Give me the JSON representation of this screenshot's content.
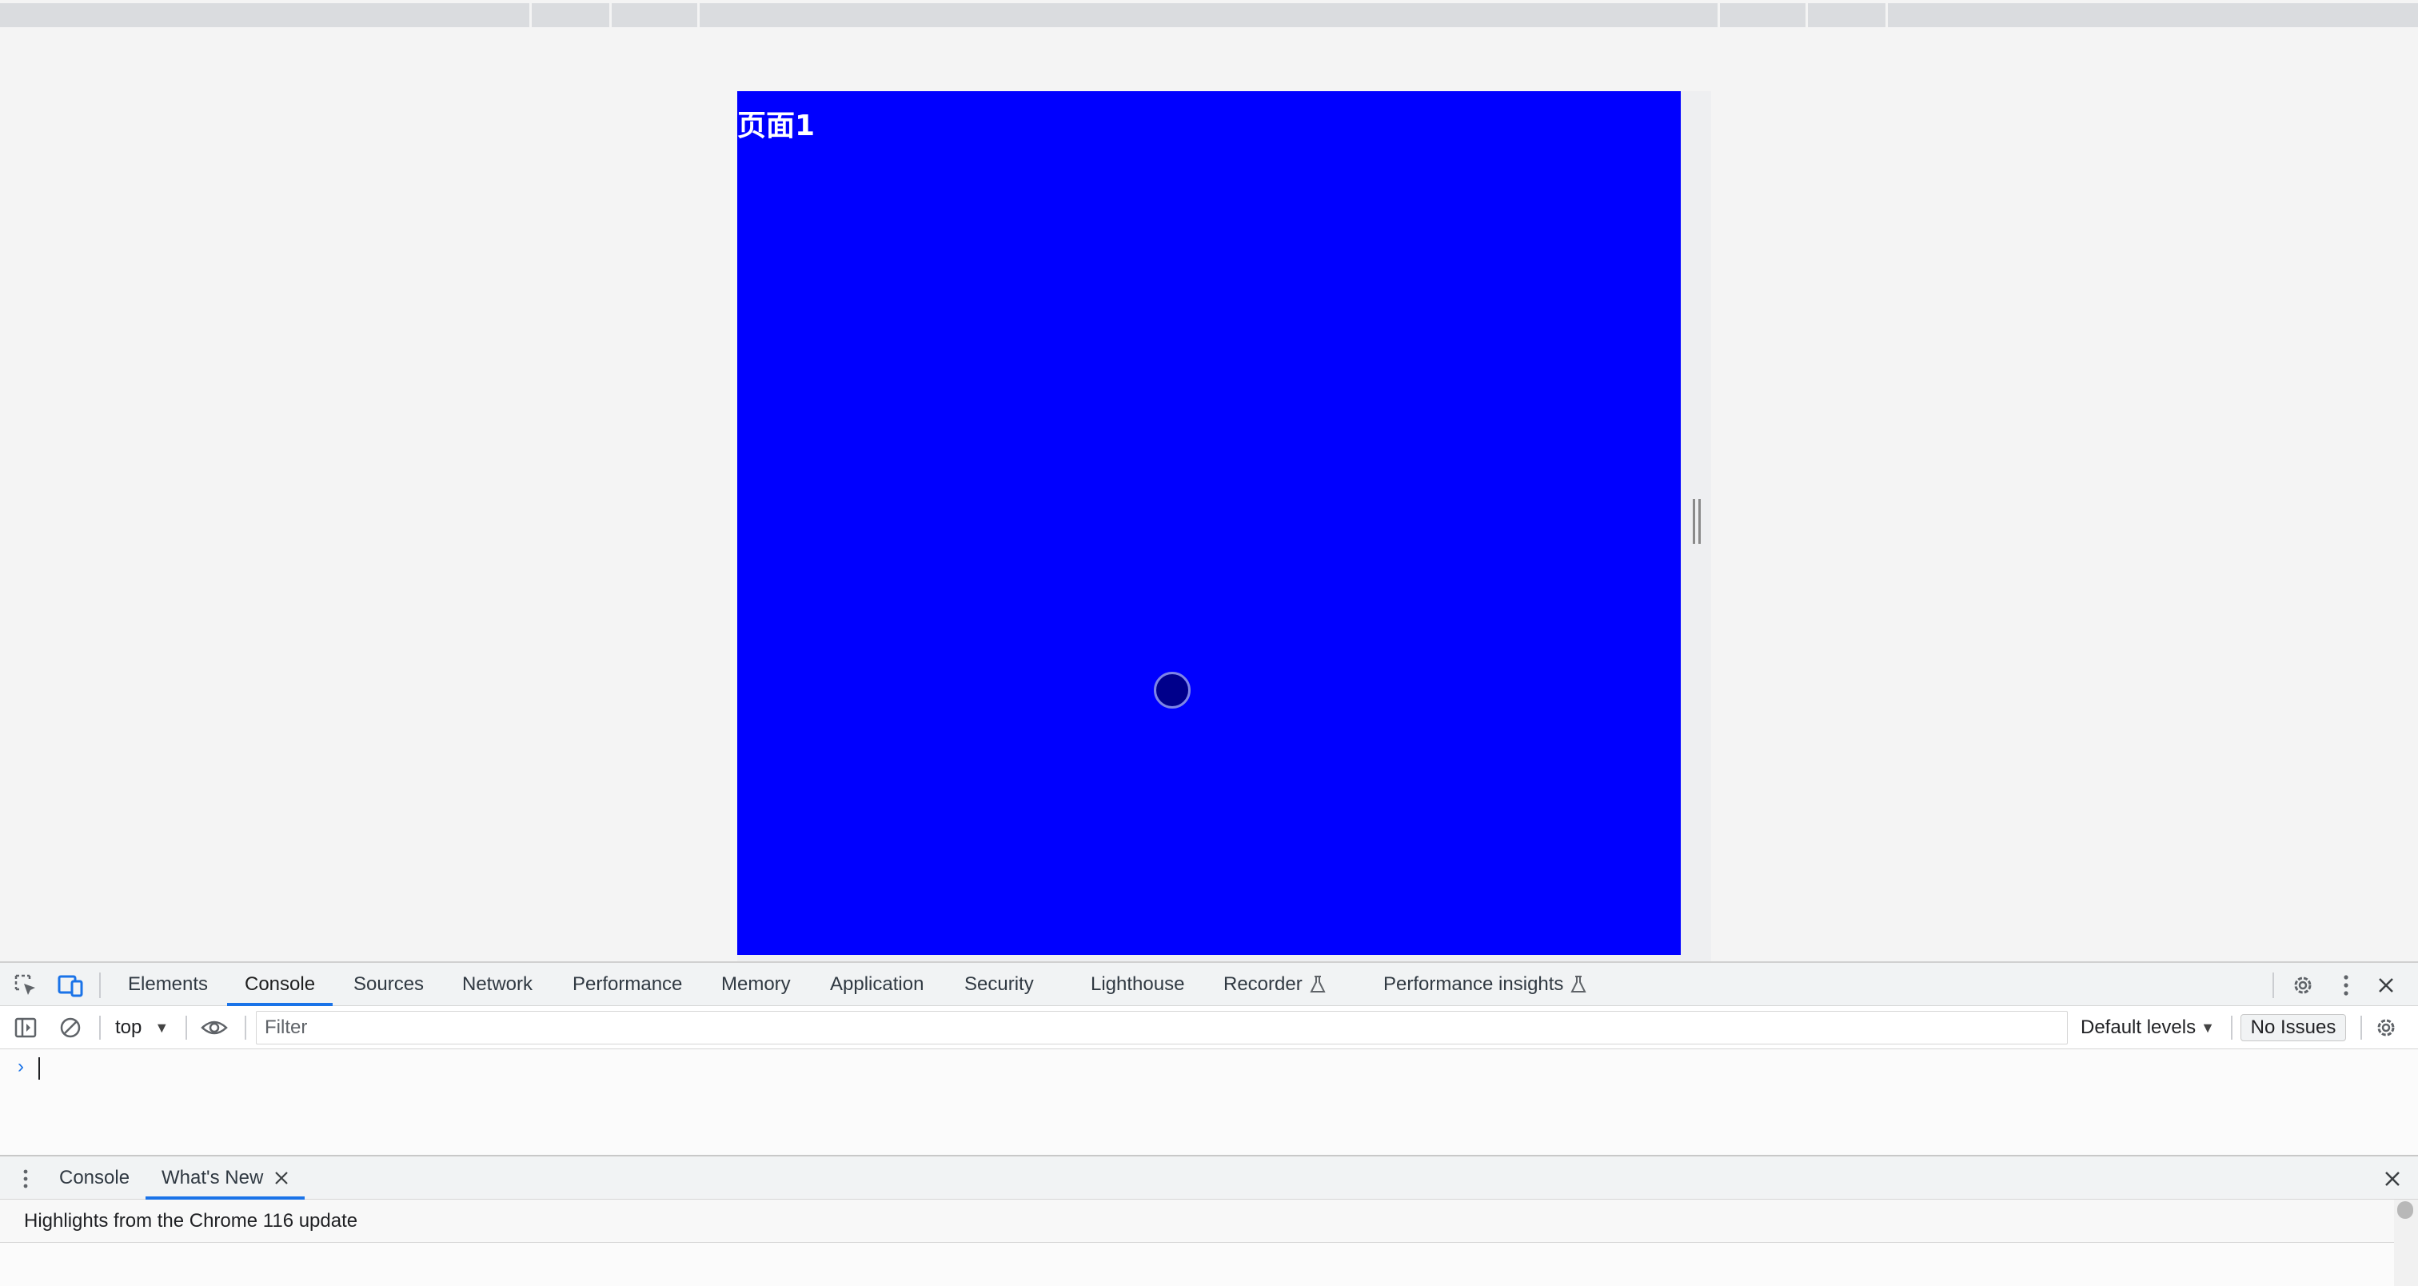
{
  "viewport": {
    "page_title": "页面1",
    "page_background": "#0000ff"
  },
  "devtools": {
    "tabs": [
      "Elements",
      "Console",
      "Sources",
      "Network",
      "Performance",
      "Memory",
      "Application",
      "Security",
      "Lighthouse",
      "Recorder",
      "Performance insights"
    ],
    "active_tab": "Console",
    "icons": [
      "inspect-element-icon",
      "device-toolbar-icon",
      "settings-gear-icon",
      "more-options-icon",
      "close-icon"
    ]
  },
  "console_toolbar": {
    "context": "top",
    "filter_placeholder": "Filter",
    "levels": "Default levels",
    "issues": "No Issues"
  },
  "console": {
    "prompt": "›"
  },
  "drawer": {
    "tabs": [
      "Console",
      "What's New"
    ],
    "active_tab": "What's New",
    "banner_text": "Highlights from the Chrome 116 update"
  },
  "colors": {
    "accent": "#1a73e8",
    "page_blue": "#0000ff"
  }
}
